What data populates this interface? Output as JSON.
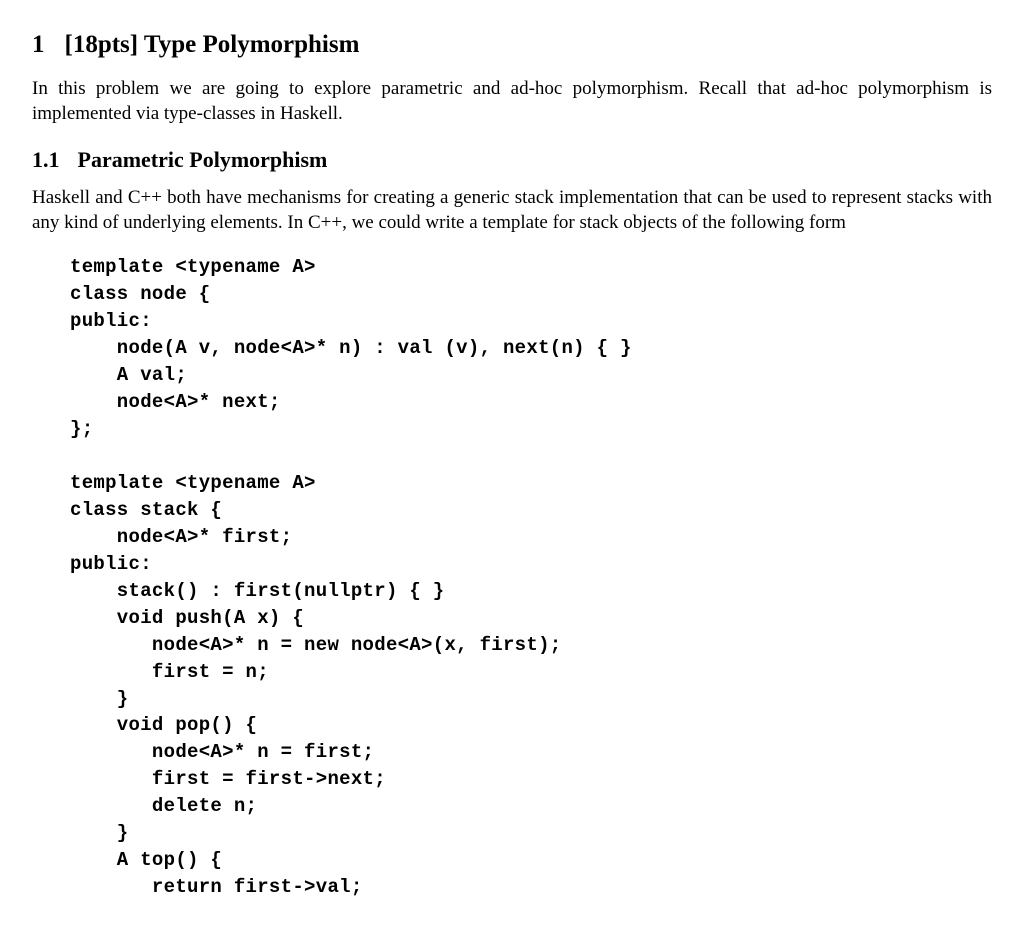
{
  "section": {
    "number": "1",
    "title": "[18pts] Type Polymorphism"
  },
  "intro_para": "In this problem we are going to explore parametric and ad-hoc polymorphism. Recall that ad-hoc polymorphism is implemented via type-classes in Haskell.",
  "subsection": {
    "number": "1.1",
    "title": "Parametric Polymorphism"
  },
  "sub_para": "Haskell and C++ both have mechanisms for creating a generic stack implementation that can be used to represent stacks with any kind of underlying elements. In C++, we could write a template for stack objects of the following form",
  "code": "template <typename A>\nclass node {\npublic:\n    node(A v, node<A>* n) : val (v), next(n) { }\n    A val;\n    node<A>* next;\n};\n\ntemplate <typename A>\nclass stack {\n    node<A>* first;\npublic:\n    stack() : first(nullptr) { }\n    void push(A x) {\n       node<A>* n = new node<A>(x, first);\n       first = n;\n    }\n    void pop() {\n       node<A>* n = first;\n       first = first->next;\n       delete n;\n    }\n    A top() {\n       return first->val;"
}
